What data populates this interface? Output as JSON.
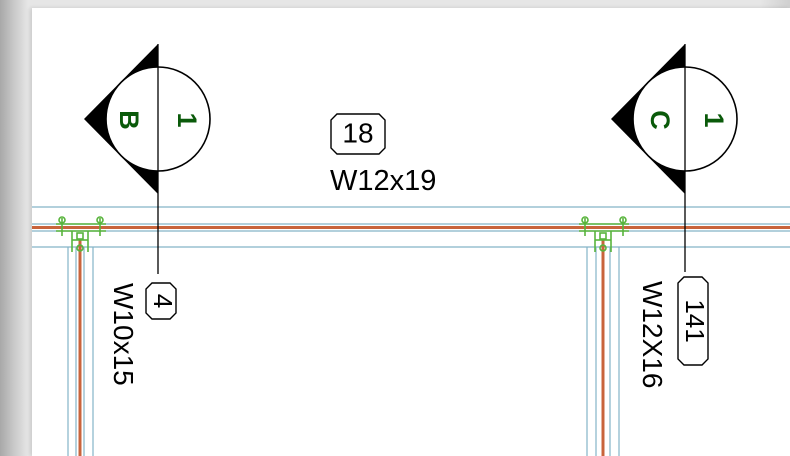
{
  "section_markers": [
    {
      "letter": "B",
      "number": "1"
    },
    {
      "letter": "C",
      "number": "1"
    }
  ],
  "beam": {
    "tag": "18",
    "size": "W12x19"
  },
  "columns": [
    {
      "tag": "4",
      "size": "W10x15"
    },
    {
      "tag": "141",
      "size": "W12X16"
    }
  ],
  "colors": {
    "marker_text": "#0a5a0a",
    "member_fill": "#c8643c",
    "member_outline": "#84b4c8",
    "connection": "#58b43c",
    "line": "#000000"
  }
}
